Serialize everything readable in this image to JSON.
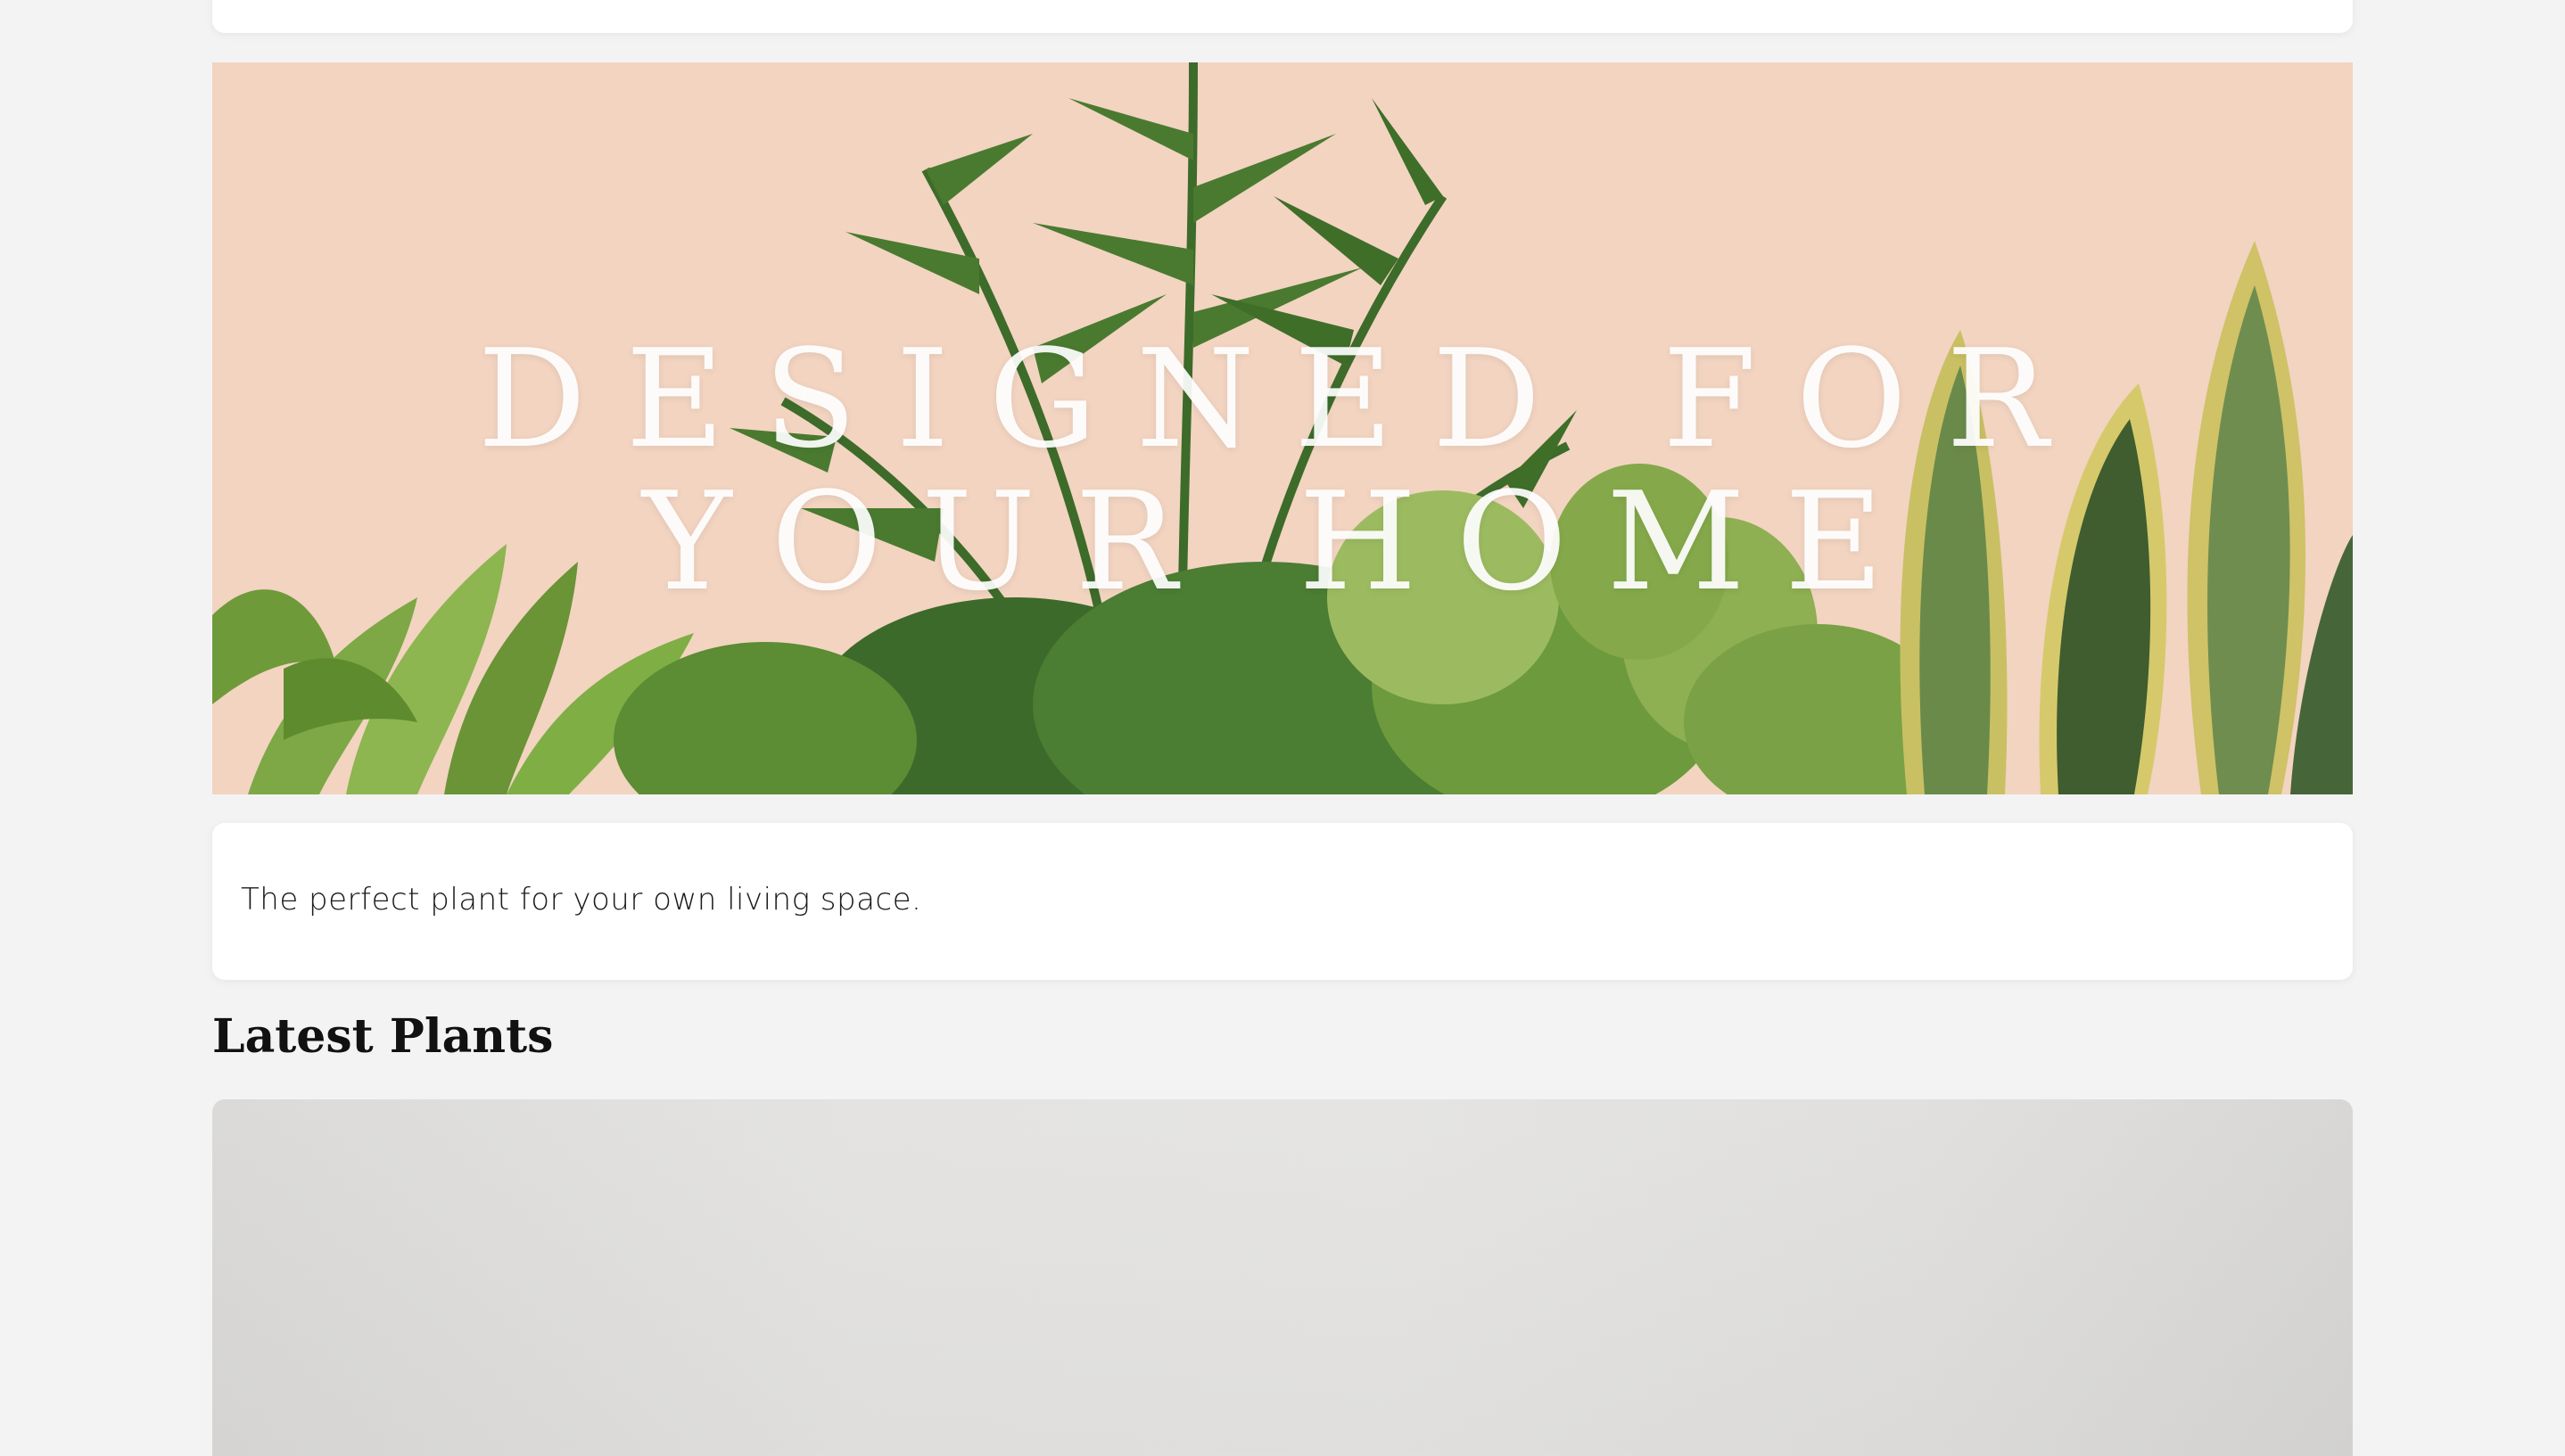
{
  "hero": {
    "title_line1": "DESIGNED FOR",
    "title_line2": "YOUR HOME",
    "background_color": "#f2d4c1"
  },
  "tagline": {
    "text": "The perfect plant for your own living space."
  },
  "latest": {
    "heading": "Latest Plants"
  },
  "colors": {
    "page_background": "#f3f3f3",
    "card_background": "#ffffff",
    "leaf_dark": "#3f6a2a",
    "leaf_mid": "#5e8a34",
    "leaf_light": "#8fb24c",
    "snake_yellow": "#c9c064"
  }
}
